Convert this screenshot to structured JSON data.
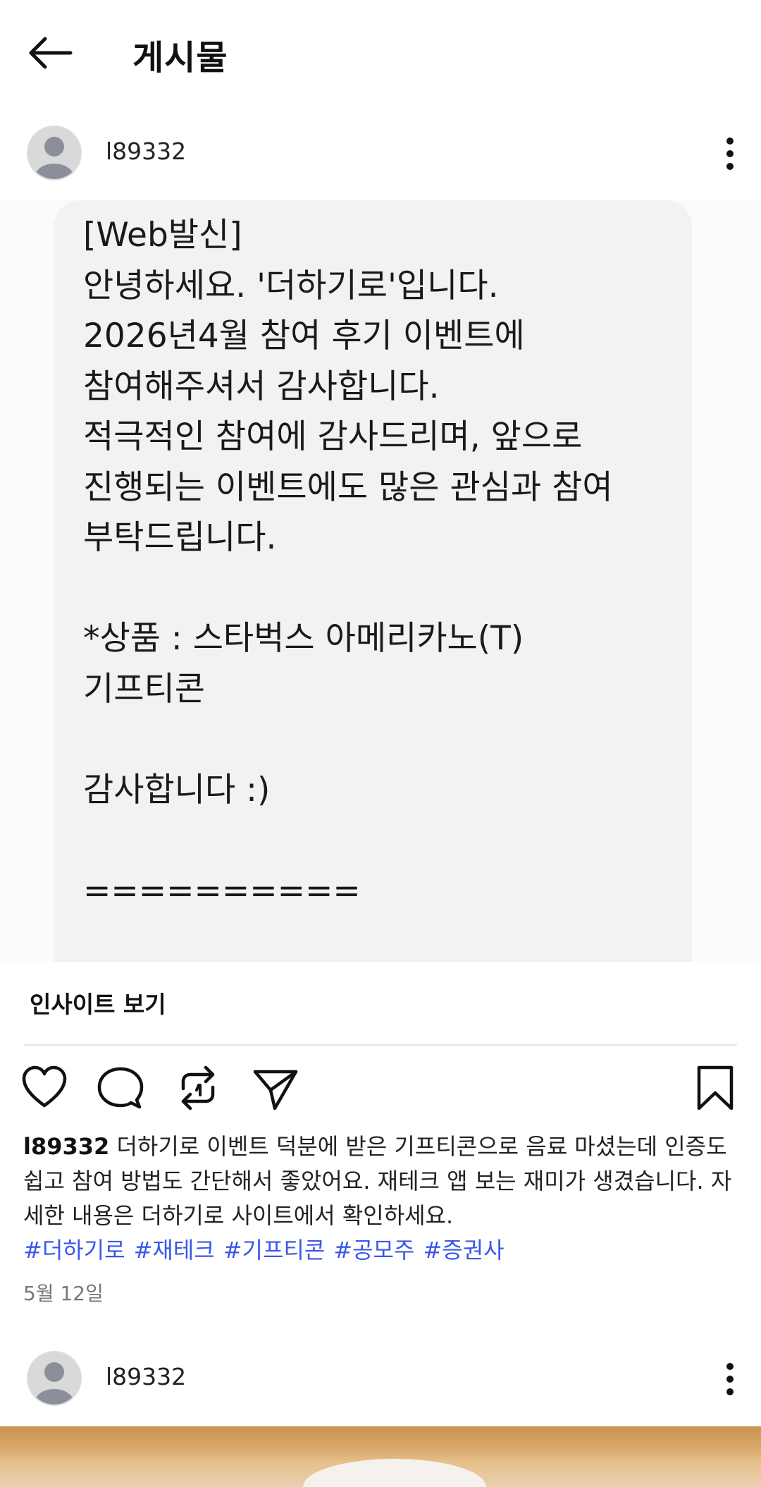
{
  "header": {
    "title": "게시물",
    "back_icon": "arrow-left-icon"
  },
  "post": {
    "username": "l89332",
    "image": {
      "lines": [
        "[Web발신]",
        "안녕하세요. '더하기로'입니다.",
        "2026년4월 참여 후기 이벤트에",
        "참여해주셔서 감사합니다.",
        "적극적인 참여에 감사드리며, 앞으로",
        "진행되는 이벤트에도 많은 관심과 참여",
        "부탁드립니다.",
        "",
        "*상품 : 스타벅스 아메리카노(T)",
        "기프티콘",
        "",
        "감사합니다 :)",
        "",
        "=========="
      ]
    },
    "insight_label": "인사이트 보기",
    "actions": [
      "heart-icon",
      "comment-icon",
      "repost-icon",
      "share-icon",
      "bookmark-icon"
    ],
    "caption": {
      "username": "l89332",
      "text": "더하기로 이벤트 덕분에 받은 기프티콘으로 음료 마셨는데 인증도 쉽고 참여 방법도 간단해서 좋았어요. 재테크 앱 보는 재미가 생겼습니다. 자세한 내용은 더하기로 사이트에서 확인하세요.",
      "hashtags": [
        "#더하기로",
        "#재테크",
        "#기프티콘",
        "#공모주",
        "#증권사"
      ]
    },
    "date": "5월 12일"
  },
  "next_post": {
    "username": "l89332"
  },
  "colors": {
    "hashtag": "#3a57e8",
    "bubble": "#f2f2f2",
    "date": "#777777"
  }
}
